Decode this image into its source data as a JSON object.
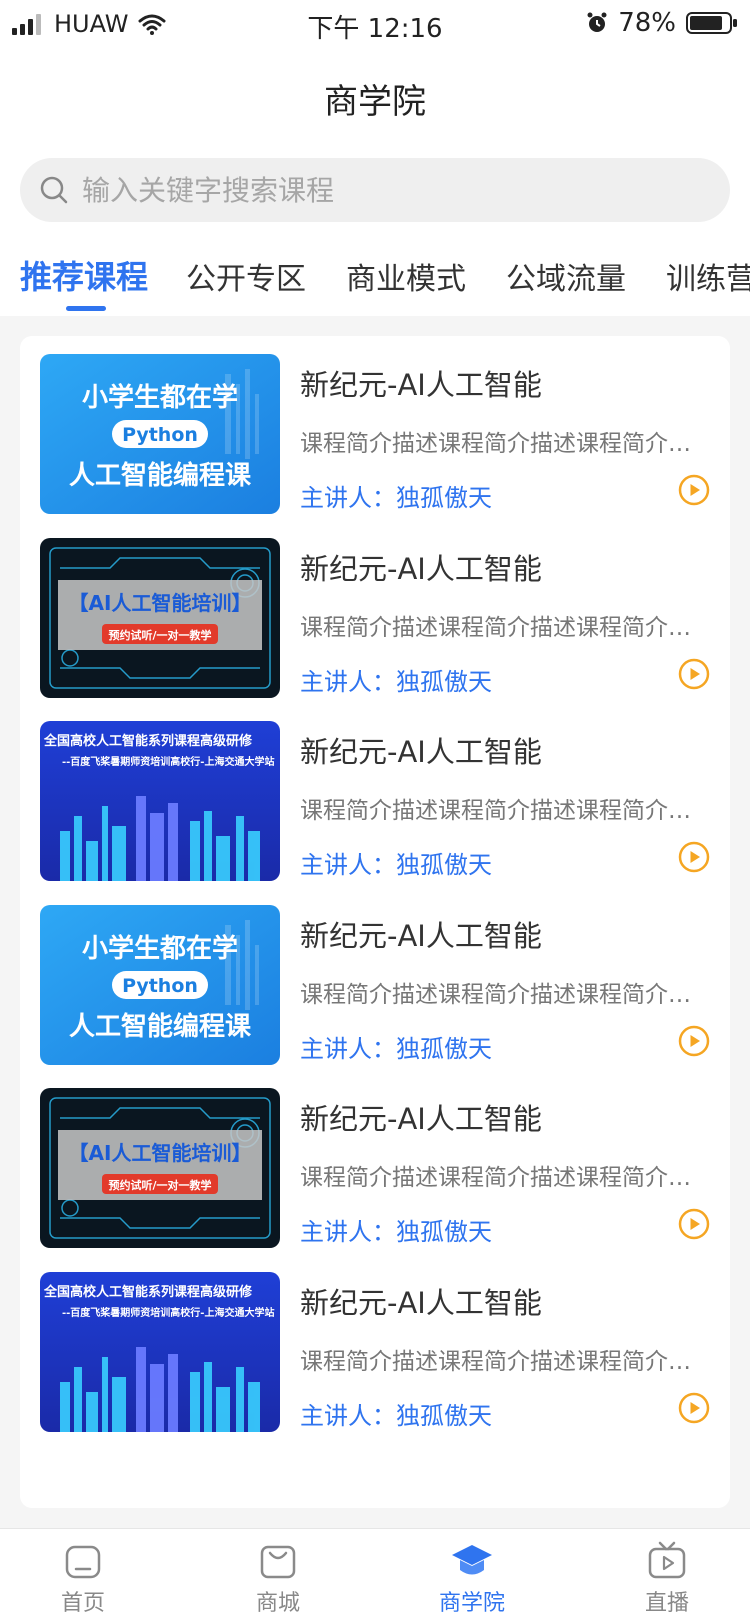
{
  "status_bar": {
    "carrier": "HUAW",
    "time": "下午 12:16",
    "battery": "78%"
  },
  "header": {
    "title": "商学院"
  },
  "search": {
    "placeholder": "输入关键字搜索课程"
  },
  "tabs": [
    {
      "label": "推荐课程",
      "active": true
    },
    {
      "label": "公开专区"
    },
    {
      "label": "商业模式"
    },
    {
      "label": "公域流量"
    },
    {
      "label": "训练营"
    }
  ],
  "thumbs": {
    "python": {
      "line1": "小学生都在学",
      "badge": "Python",
      "line2": "人工智能编程课"
    },
    "ai_training": {
      "title": "【AI人工智能培训】",
      "sub": "预约试听/一对一教学"
    },
    "seminar": {
      "title": "全国高校人工智能系列课程高级研修",
      "sub": "--百度飞桨暑期师资培训高校行-上海交通大学站"
    }
  },
  "courses": [
    {
      "thumb": "python",
      "title": "新纪元-AI人工智能",
      "desc": "课程简介描述课程简介描述课程简介描述",
      "lecturer": "主讲人：独孤傲天"
    },
    {
      "thumb": "ai_training",
      "title": "新纪元-AI人工智能",
      "desc": "课程简介描述课程简介描述课程简介描述",
      "lecturer": "主讲人：独孤傲天"
    },
    {
      "thumb": "seminar",
      "title": "新纪元-AI人工智能",
      "desc": "课程简介描述课程简介描述课程简介描述",
      "lecturer": "主讲人：独孤傲天"
    },
    {
      "thumb": "python",
      "title": "新纪元-AI人工智能",
      "desc": "课程简介描述课程简介描述课程简介描述",
      "lecturer": "主讲人：独孤傲天"
    },
    {
      "thumb": "ai_training",
      "title": "新纪元-AI人工智能",
      "desc": "课程简介描述课程简介描述课程简介描述",
      "lecturer": "主讲人：独孤傲天"
    },
    {
      "thumb": "seminar",
      "title": "新纪元-AI人工智能",
      "desc": "课程简介描述课程简介描述课程简介描述",
      "lecturer": "主讲人：独孤傲天"
    }
  ],
  "tabbar": [
    {
      "label": "首页",
      "icon": "home-icon"
    },
    {
      "label": "商城",
      "icon": "shopping-bag-icon"
    },
    {
      "label": "商学院",
      "icon": "graduation-cap-icon",
      "active": true
    },
    {
      "label": "直播",
      "icon": "tv-play-icon"
    }
  ],
  "colors": {
    "accent": "#2f74ef",
    "play": "#f5a623"
  }
}
